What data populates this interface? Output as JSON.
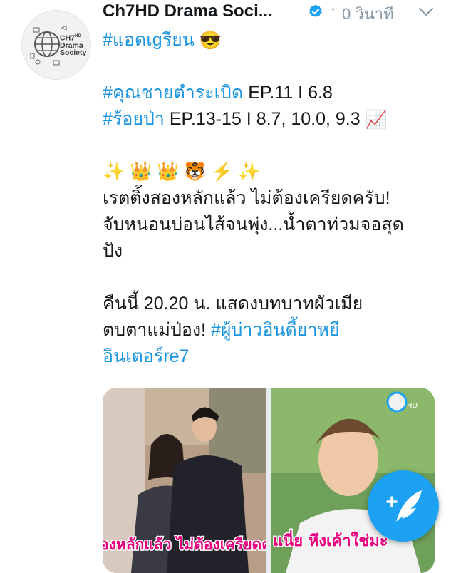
{
  "account": {
    "display_name": "Ch7HD Drama Soci...",
    "avatar_text": [
      "CH7",
      "Drama",
      "Society"
    ],
    "avatar_badge": "HD",
    "verified": true,
    "separator": "·",
    "timestamp": "0 วินาที",
    "menu_icon": "chevron-down-icon"
  },
  "tweet": {
    "lines": [
      {
        "tag": "#แอดเgรียน",
        "emoji": "😎"
      },
      {
        "tag": "#คุณชายตำระเบิด",
        "text": " EP.11 I 6.8"
      },
      {
        "tag": "#ร้อยป่า",
        "text": " EP.13-15 I 8.7, 10.0, 9.3 ",
        "emoji": "📈"
      },
      {
        "emojis": "✨ 👑 👑 🐯 ⚡ ✨"
      },
      {
        "text": "เรตติ้งสองหลักแล้ว ไม่ต้องเครียดครับ!"
      },
      {
        "text": "จับหนอนบ่อนไส้จนพุ่ง...น้ำตาท่วมจอสุด"
      },
      {
        "text": "ปัง"
      },
      {
        "text": "คืนนี้ 20.20 น. แสดงบทบาทผัวเมีย"
      },
      {
        "text": "ตบตาแม่ป่อง! ",
        "tag": "#ผู้บ่าวอินดี้ยาหยี"
      },
      {
        "tag": "อินเตอร์re7"
      }
    ]
  },
  "media": {
    "image1_caption": "องหลักแล้ว ไม่ต้องเครียดครับ",
    "image2_caption": "แนี่ย หึงเค้าใช่มะ",
    "image2_logo": "HD"
  },
  "compose_button": {
    "icon": "compose-feather-icon",
    "label": "+"
  },
  "colors": {
    "link": "#1b95e0",
    "verified": "#1da1f2",
    "fab": "#1da1f2",
    "muted": "#8899a6"
  }
}
